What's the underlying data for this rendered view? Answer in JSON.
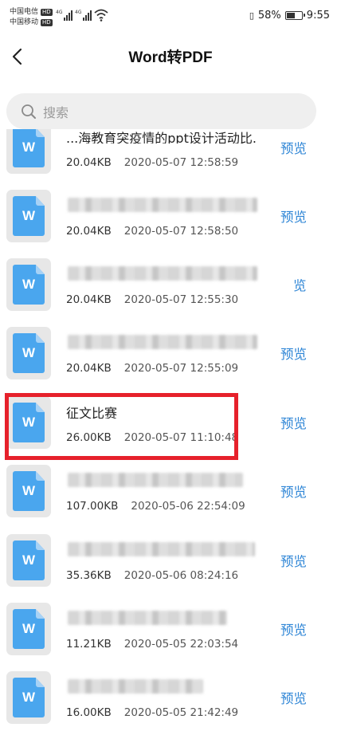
{
  "status_bar": {
    "carrier1": "中国电信",
    "carrier2": "中国移动",
    "hd": "HD",
    "net": "4G",
    "battery": "58%",
    "battery_level": 0.58,
    "time": "9:55"
  },
  "header": {
    "back_icon": "chevron-left-icon",
    "title": "Word转PDF"
  },
  "search": {
    "icon": "search-icon",
    "placeholder": "搜索"
  },
  "accent_color": "#2f86d6",
  "highlight_color": "#e6212b",
  "file_icon_letter": "W",
  "files": [
    {
      "name": "...海教育突疫情的ppt设计活动比...",
      "size": "20.04KB",
      "date": "2020-05-07 12:58:59",
      "preview": "预览"
    },
    {
      "name": "",
      "size": "20.04KB",
      "date": "2020-05-07 12:58:50",
      "preview": "预览"
    },
    {
      "name": "",
      "size": "20.04KB",
      "date": "2020-05-07 12:55:30",
      "preview": "览"
    },
    {
      "name": "",
      "size": "20.04KB",
      "date": "2020-05-07 12:55:09",
      "preview": "预览"
    },
    {
      "name": "征文比赛",
      "size": "26.00KB",
      "date": "2020-05-07 11:10:48",
      "preview": "预览"
    },
    {
      "name": "",
      "size": "107.00KB",
      "date": "2020-05-06 22:54:09",
      "preview": "预览"
    },
    {
      "name": "",
      "size": "35.36KB",
      "date": "2020-05-06 08:24:16",
      "preview": "预览"
    },
    {
      "name": "",
      "size": "11.21KB",
      "date": "2020-05-05 22:03:54",
      "preview": "预览"
    },
    {
      "name": "",
      "size": "16.00KB",
      "date": "2020-05-05 21:42:49",
      "preview": "预览"
    }
  ]
}
